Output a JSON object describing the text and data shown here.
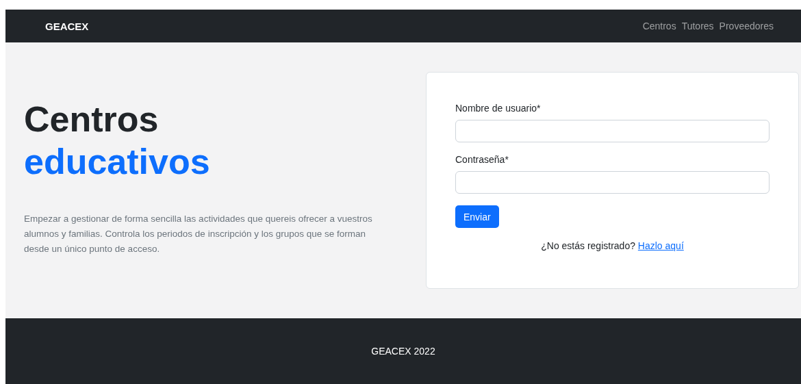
{
  "navbar": {
    "brand": "GEACEX",
    "links": [
      "Centros",
      "Tutores",
      "Proveedores"
    ]
  },
  "hero": {
    "title_line_1": "Centros",
    "title_line_2": "educativos",
    "description": "Empezar a gestionar de forma sencilla las actividades que quereis ofrecer a vuestros alumnos y familias. Controla los periodos de inscripción y los grupos que se forman desde un único punto de acceso."
  },
  "login_form": {
    "fields": [
      {
        "label": "Nombre de usuario*"
      },
      {
        "label": "Contraseña*"
      }
    ],
    "submit": "Enviar",
    "signup_prompt": "¿No estás registrado?",
    "signup_link": "Hazlo aquí"
  },
  "footer": {
    "text": "GEACEX 2022"
  }
}
